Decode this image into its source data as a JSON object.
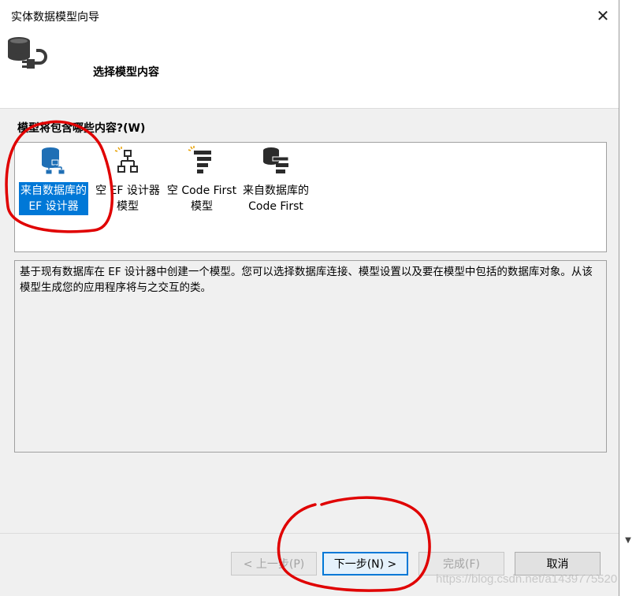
{
  "window": {
    "title": "实体数据模型向导",
    "close_glyph": "✕"
  },
  "header": {
    "title": "选择模型内容",
    "icon": "database-plug-icon"
  },
  "question": "模型将包含哪些内容?(W)",
  "options": [
    {
      "label": "来自数据库的\nEF 设计器",
      "icon": "database-hierarchy-icon",
      "selected": true
    },
    {
      "label": "空 EF 设计器\n模型",
      "icon": "empty-hierarchy-icon",
      "selected": false
    },
    {
      "label": "空 Code First\n模型",
      "icon": "empty-code-first-icon",
      "selected": false
    },
    {
      "label": "来自数据库的\nCode First",
      "icon": "database-code-first-icon",
      "selected": false
    }
  ],
  "description": "基于现有数据库在 EF 设计器中创建一个模型。您可以选择数据库连接、模型设置以及要在模型中包括的数据库对象。从该模型生成您的应用程序将与之交互的类。",
  "buttons": {
    "back": "< 上一步(P)",
    "next": "下一步(N) >",
    "finish": "完成(F)",
    "cancel": "取消"
  },
  "watermark": "https://blog.csdn.net/a1439775520",
  "colors": {
    "selection": "#0078d7",
    "annotation": "#e00000",
    "dialog_bg": "#f0f0f0"
  }
}
